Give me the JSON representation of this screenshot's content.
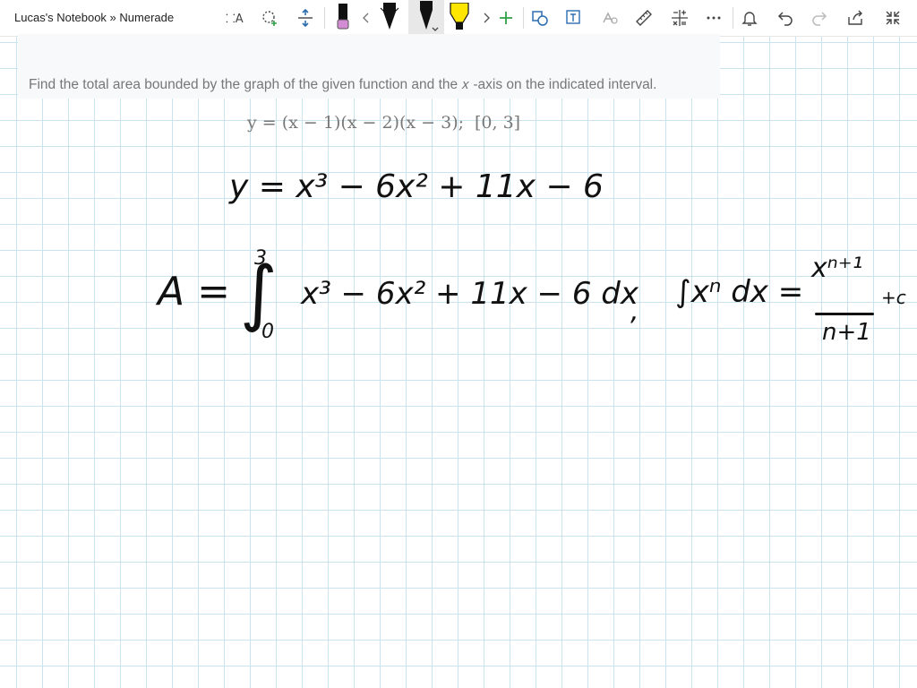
{
  "window": {
    "title": "Lucas's Notebook » Numerade"
  },
  "toolbar": {
    "items": [
      {
        "name": "lasso-text-icon"
      },
      {
        "name": "lasso-add-icon"
      },
      {
        "name": "add-space-icon"
      },
      {
        "name": "pen-black-pink-icon"
      },
      {
        "name": "scroll-left-icon"
      },
      {
        "name": "pen-black-icon"
      },
      {
        "name": "pen-black-selected-icon"
      },
      {
        "name": "highlighter-yellow-icon"
      },
      {
        "name": "scroll-right-icon"
      },
      {
        "name": "add-pen-icon"
      },
      {
        "name": "ink-to-shape-icon"
      },
      {
        "name": "ink-to-text-icon"
      },
      {
        "name": "ink-to-math-icon"
      },
      {
        "name": "ruler-icon"
      },
      {
        "name": "math-icon"
      },
      {
        "name": "more-icon"
      },
      {
        "name": "notifications-icon"
      },
      {
        "name": "undo-icon"
      },
      {
        "name": "redo-icon"
      },
      {
        "name": "share-icon"
      },
      {
        "name": "fullscreen-icon"
      }
    ]
  },
  "question": {
    "text": "Find the total area bounded by the graph of the given function and the 𝑥 -axis on the indicated interval.",
    "formula": "y = (x − 1)(x − 2)(x − 3);",
    "interval": "[0, 3]"
  },
  "ink": {
    "line1": "y = x³ − 6x² + 11x − 6",
    "line2_left": "A =",
    "integral_upper": "3",
    "integral_lower": "0",
    "line2_integrand": "x³ − 6x² + 11x − 6 dx",
    "comma": ",",
    "rule_left": "∫xⁿ dx =",
    "rule_numerator": "xⁿ⁺¹",
    "rule_denominator": "n+1",
    "rule_constant": "+c"
  },
  "colors": {
    "grid": "#c9e4ef",
    "highlighter": "#ffe600",
    "accent_green": "#2ea043"
  }
}
